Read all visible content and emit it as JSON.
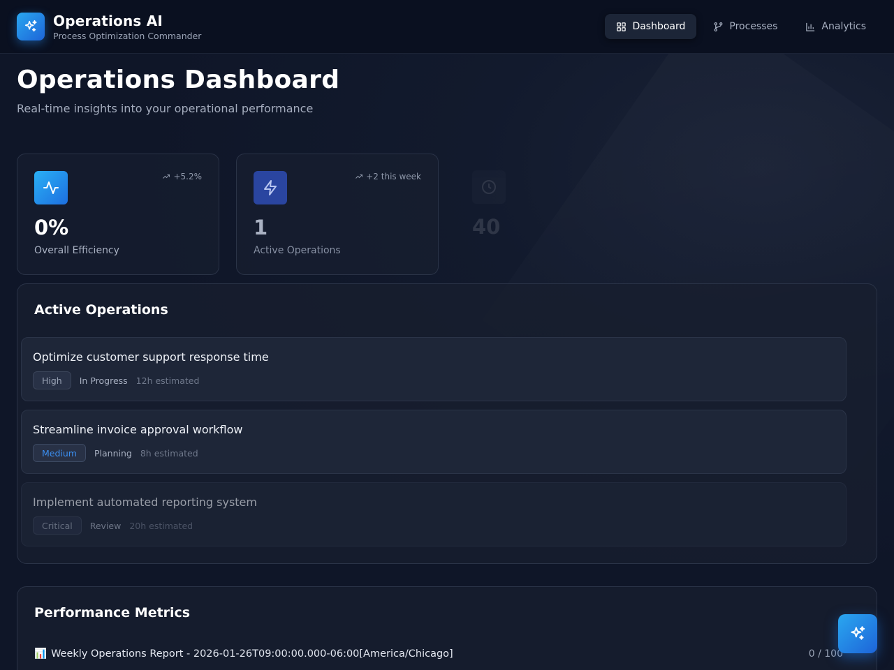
{
  "app": {
    "title": "Operations AI",
    "subtitle": "Process Optimization Commander"
  },
  "nav": {
    "items": [
      {
        "label": "Dashboard",
        "icon": "grid-icon",
        "active": true
      },
      {
        "label": "Processes",
        "icon": "branch-icon",
        "active": false
      },
      {
        "label": "Analytics",
        "icon": "bar-chart-icon",
        "active": false
      }
    ]
  },
  "page": {
    "title": "Operations Dashboard",
    "subtitle": "Real-time insights into your operational performance"
  },
  "stats": [
    {
      "value": "0%",
      "label": "Overall Efficiency",
      "trend": "+5.2%",
      "icon": "activity-icon",
      "color": "#2a9ef0"
    },
    {
      "value": "1",
      "label": "Active Operations",
      "trend": "+2 this week",
      "icon": "zap-icon",
      "color": "#2a4aa0"
    },
    {
      "value": "40",
      "label": "",
      "trend": "",
      "icon": "clock-icon",
      "color": "#3b4356"
    }
  ],
  "active_operations": {
    "title": "Active Operations",
    "items": [
      {
        "title": "Optimize customer support response time",
        "priority": "High",
        "status": "In Progress",
        "estimate": "12h estimated",
        "priority_color": "#9aa3b5"
      },
      {
        "title": "Streamline invoice approval workflow",
        "priority": "Medium",
        "status": "Planning",
        "estimate": "8h estimated",
        "priority_color": "#3b8ef0"
      },
      {
        "title": "Implement automated reporting system",
        "priority": "Critical",
        "status": "Review",
        "estimate": "20h estimated",
        "priority_color": "#9aa3b5"
      }
    ]
  },
  "performance": {
    "title": "Performance Metrics",
    "report_icon": "📊",
    "report_title": "Weekly Operations Report - 2026-01-26T09:00:00.000-06:00[America/Chicago]",
    "score": "0 / 100"
  },
  "fab": {
    "icon": "sparkle-icon"
  }
}
